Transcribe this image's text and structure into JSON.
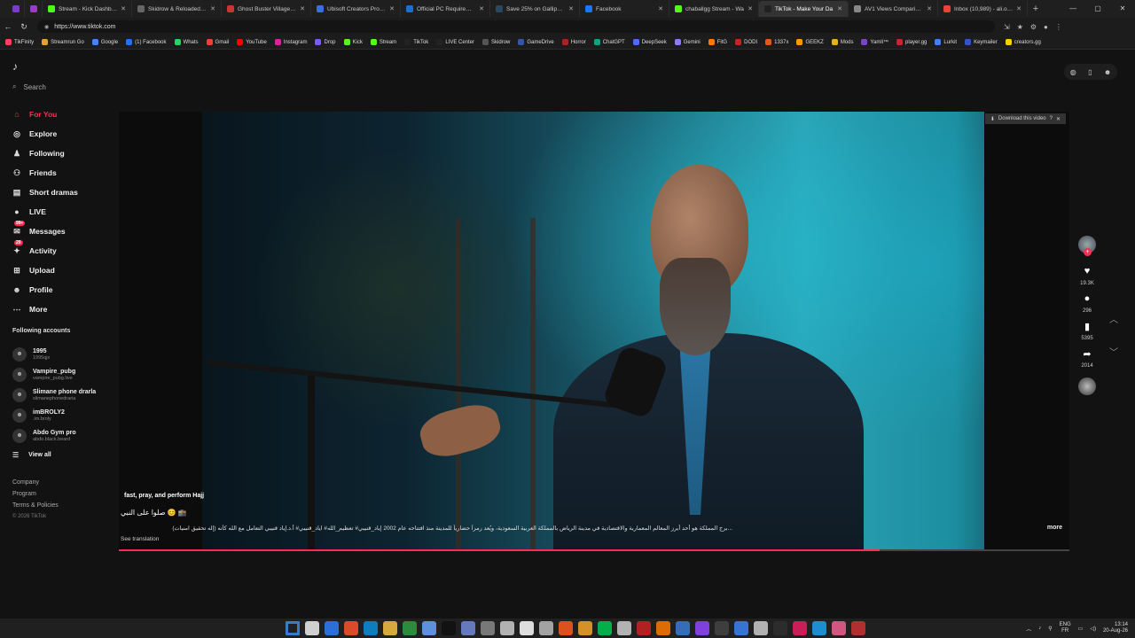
{
  "browser": {
    "tabs": [
      {
        "title": "Stream - Kick Dashboard",
        "color": "#53fc18"
      },
      {
        "title": "Skidrow & Reloaded Games",
        "color": "#666666"
      },
      {
        "title": "Ghost Buster Village-P2P",
        "color": "#cc3333"
      },
      {
        "title": "Ubisoft Creators Program",
        "color": "#3c6fd8"
      },
      {
        "title": "Official PC Requirements f",
        "color": "#1a6fd1"
      },
      {
        "title": "Save 25% on Gallipoli on S",
        "color": "#2a475e"
      },
      {
        "title": "Facebook",
        "color": "#1877f2"
      },
      {
        "title": "chaballgg Stream - Wa",
        "color": "#53fc18"
      },
      {
        "title": "TikTok - Make Your Da",
        "color": "#222222",
        "active": true
      },
      {
        "title": "AV1 Views Comparison",
        "color": "#888888"
      },
      {
        "title": "Inbox (10,989) - ali.ouckri",
        "color": "#ea4335"
      }
    ],
    "url": "https://www.tiktok.com",
    "bookmarks": [
      {
        "label": "TikFinity",
        "color": "#ff4060"
      },
      {
        "label": "Streamrun Go",
        "color": "#e8a030"
      },
      {
        "label": "Google",
        "color": "#4285f4"
      },
      {
        "label": "(1) Facebook",
        "color": "#1877f2"
      },
      {
        "label": "Whats",
        "color": "#25d366"
      },
      {
        "label": "Gmail",
        "color": "#ea4335"
      },
      {
        "label": "YouTube",
        "color": "#ff0000"
      },
      {
        "label": "Instagram",
        "color": "#d6249f"
      },
      {
        "label": "Drop",
        "color": "#7b5cff"
      },
      {
        "label": "Kick",
        "color": "#53fc18"
      },
      {
        "label": "Stream",
        "color": "#53fc18"
      },
      {
        "label": "TikTok",
        "color": "#222222"
      },
      {
        "label": "LIVE Center",
        "color": "#222222"
      },
      {
        "label": "Skidrow",
        "color": "#555555"
      },
      {
        "label": "GameDrive",
        "color": "#3355aa"
      },
      {
        "label": "Horror",
        "color": "#aa2222"
      },
      {
        "label": "ChatGPT",
        "color": "#10a37f"
      },
      {
        "label": "DeepSeek",
        "color": "#4d6bfe"
      },
      {
        "label": "Gemini",
        "color": "#8a7bff"
      },
      {
        "label": "FitG",
        "color": "#ff7a00"
      },
      {
        "label": "DODI",
        "color": "#cc2222"
      },
      {
        "label": "1337x",
        "color": "#e05a1c"
      },
      {
        "label": "GEEKZ",
        "color": "#ff9900"
      },
      {
        "label": "Mods",
        "color": "#e8b020"
      },
      {
        "label": "Yamli™",
        "color": "#7744cc"
      },
      {
        "label": "player.gg",
        "color": "#cc2233"
      },
      {
        "label": "Lurkit",
        "color": "#3b82f6"
      },
      {
        "label": "Keymailer",
        "color": "#3355cc"
      },
      {
        "label": "creators.gg",
        "color": "#ffd000"
      }
    ]
  },
  "tiktok": {
    "search_placeholder": "Search",
    "nav": [
      {
        "label": "For You",
        "icon": "home-icon",
        "glyph": "⌂",
        "active": true
      },
      {
        "label": "Explore",
        "icon": "compass-icon",
        "glyph": "◎"
      },
      {
        "label": "Following",
        "icon": "following-icon",
        "glyph": "♟"
      },
      {
        "label": "Friends",
        "icon": "friends-icon",
        "glyph": "⚇"
      },
      {
        "label": "Short dramas",
        "icon": "film-icon",
        "glyph": "▤"
      },
      {
        "label": "LIVE",
        "icon": "live-icon",
        "glyph": "●"
      },
      {
        "label": "Messages",
        "icon": "messages-icon",
        "glyph": "✉",
        "badge": "99+"
      },
      {
        "label": "Activity",
        "icon": "activity-icon",
        "glyph": "✦",
        "badge": "20"
      },
      {
        "label": "Upload",
        "icon": "upload-icon",
        "glyph": "⊞"
      },
      {
        "label": "Profile",
        "icon": "profile-icon",
        "glyph": "☻"
      },
      {
        "label": "More",
        "icon": "more-icon",
        "glyph": "⋯"
      }
    ],
    "following_header": "Following accounts",
    "accounts": [
      {
        "name": "1995",
        "handle": "1995qjx"
      },
      {
        "name": "Vampire_pubg",
        "handle": "vampire_pubg.live"
      },
      {
        "name": "Slimane phone drarla",
        "handle": "slimanephonedraria"
      },
      {
        "name": "imBROLY2",
        "handle": ".im.broly"
      },
      {
        "name": "Abdo Gym pro",
        "handle": "abdo.black.beard"
      }
    ],
    "view_all": "View all",
    "footer": [
      "Company",
      "Program",
      "Terms & Policies"
    ],
    "copyright": "© 2026 TikTok",
    "video": {
      "download_label": "Download this video",
      "caption_title": "fast, pray, and perform Hajj",
      "caption_arabic": "صلوا على النبي 😊 🕋",
      "caption_long": "...برج المملكة هو أحد أبرز المعالم المعمارية والاقتصادية في مدينة الرياض بالمملكة العربية السعودية، ويُعد رمزاً حضارياً للمدينة منذ افتتاحه عام 2002 إياد_قنيبي# تعظيم_الله# اياد_قنيبي# أ.د.إياد قنيبي التعامل مع الله كأنه (إله تحقيق امنيات)",
      "see_translation": "See translation",
      "more_label": "more",
      "progress": 0.8
    },
    "actions": {
      "likes": "19.3K",
      "comments": "296",
      "saves": "5395",
      "shares": "2014"
    }
  },
  "taskbar": {
    "lang_top": "ENG",
    "lang_bottom": "FR",
    "time": "13:14",
    "date": "20-Aug-26",
    "icons": [
      "#3a8ee6",
      "#f0f0f0",
      "#2d7ff9",
      "#fb542b",
      "#0c8ed9",
      "#f6c343",
      "#2ea043",
      "#6ba4ff",
      "#111111",
      "#7289da",
      "#888888",
      "#cccccc",
      "#ffffff",
      "#bbbbbb",
      "#ff5a1f",
      "#f4a62a",
      "#00c853",
      "#cccccc",
      "#cc2222",
      "#ff7a00",
      "#3a7bd5",
      "#9146ff",
      "#444444",
      "#3b82f6",
      "#cccccc",
      "#2f2f2f",
      "#e91e63",
      "#1da1f2",
      "#f06292",
      "#cc3333"
    ]
  }
}
